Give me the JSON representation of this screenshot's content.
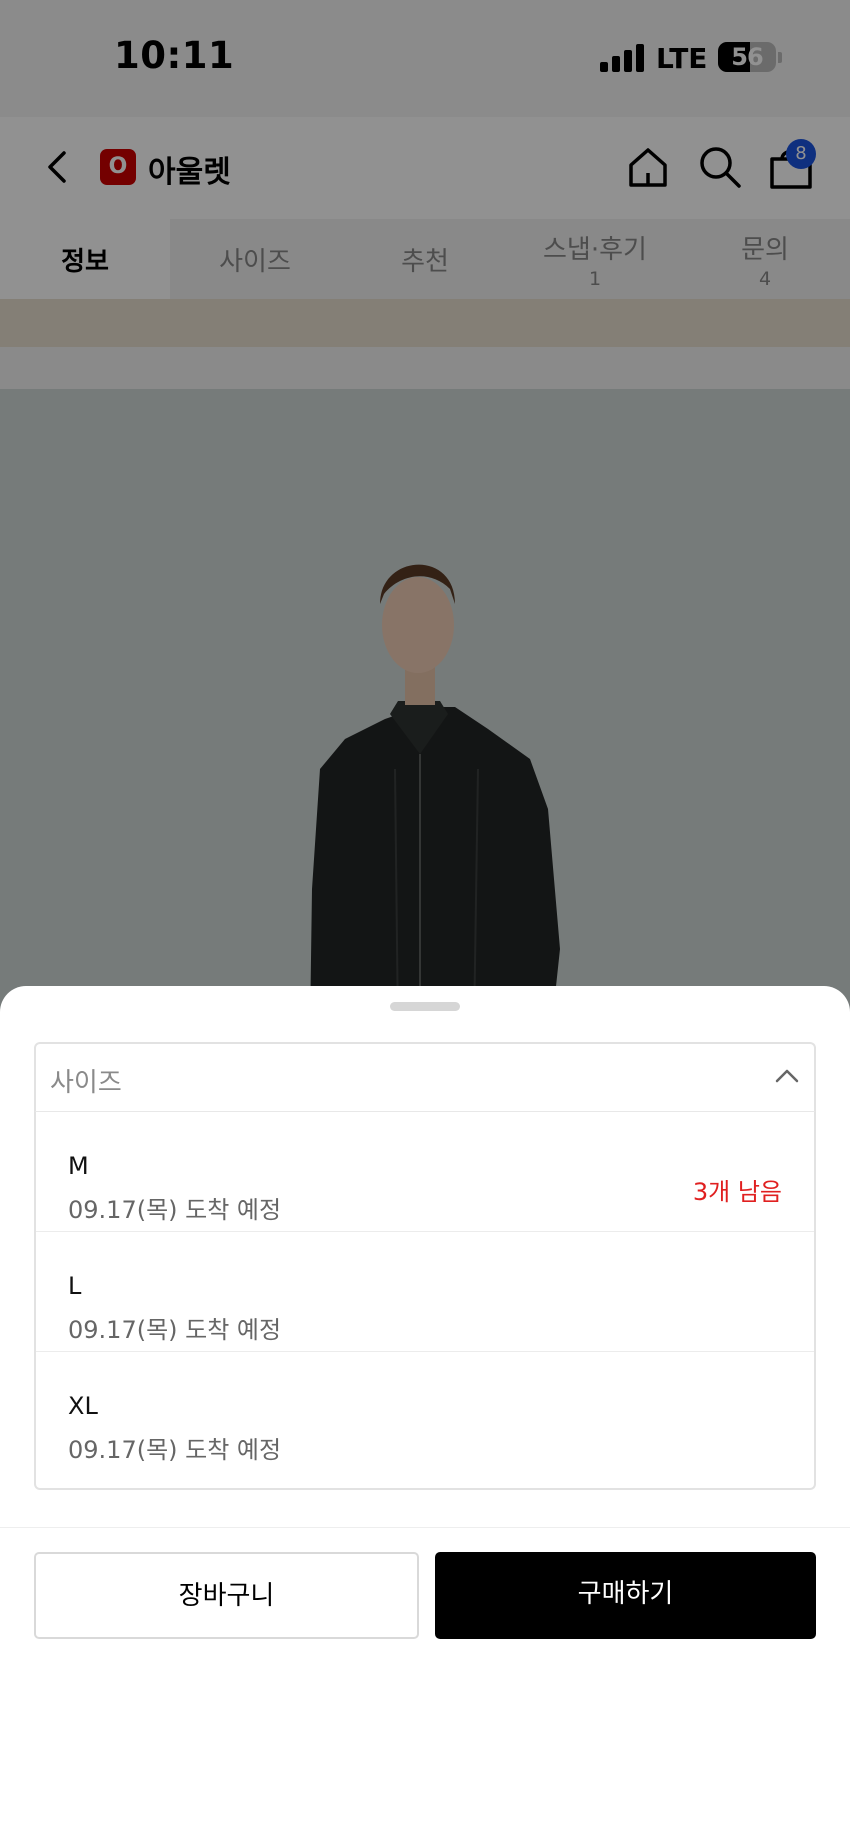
{
  "status_bar": {
    "time": "10:11",
    "network": "LTE",
    "battery_level": "56",
    "battery_percent": 56
  },
  "header": {
    "logo_letter": "O",
    "title": "아울렛",
    "cart_count": "8",
    "icons": [
      "back-icon",
      "home-icon",
      "search-icon",
      "shopping-bag-icon"
    ]
  },
  "tabs": [
    {
      "label": "정보",
      "count": "",
      "active": true
    },
    {
      "label": "사이즈",
      "count": ""
    },
    {
      "label": "추천",
      "count": ""
    },
    {
      "label": "스냅·후기",
      "count": "1"
    },
    {
      "label": "문의",
      "count": "4"
    }
  ],
  "sheet": {
    "select_label": "사이즈",
    "options": [
      {
        "size": "M",
        "eta": "09.17(목) 도착 예정",
        "stock": "3개 남음"
      },
      {
        "size": "L",
        "eta": "09.17(목) 도착 예정",
        "stock": ""
      },
      {
        "size": "XL",
        "eta": "09.17(목) 도착 예정",
        "stock": ""
      }
    ],
    "cart_button": "장바구니",
    "buy_button": "구매하기"
  },
  "colors": {
    "brand_red": "#cc0000",
    "stock_red": "#e02020",
    "badge_blue": "#1c55e0",
    "buy_black": "#000000"
  }
}
